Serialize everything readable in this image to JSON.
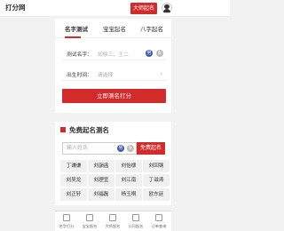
{
  "header": {
    "logo": "打分网",
    "master_button": "大师起名"
  },
  "tabs": [
    {
      "label": "名字测试"
    },
    {
      "label": "宝宝起名"
    },
    {
      "label": "八字起名"
    }
  ],
  "test_form": {
    "name_label": "测试名字：",
    "name_placeholder": "如徐三、王二",
    "male_icon": "男",
    "female_icon": "女",
    "birth_label": "出生时间：",
    "birth_placeholder": "请选择",
    "submit_label": "立即测名打分"
  },
  "free_section": {
    "title": "免费起名测名",
    "input_placeholder": "输入姓氏",
    "male_icon": "男",
    "female_icon": "女",
    "button_label": "免费起名",
    "names": [
      "丁谦谦",
      "刘韻函",
      "刘怡棣",
      "刘回钢",
      "刘吴龙",
      "刘理宜",
      "刘江南",
      "丁滋涛",
      "刘正轩",
      "刘福磊",
      "杨玉桐",
      "欧东廷"
    ]
  },
  "bottom_nav": [
    {
      "label": "名字打分"
    },
    {
      "label": "宝宝起名"
    },
    {
      "label": "大师起名"
    },
    {
      "label": "公司起名"
    },
    {
      "label": "订单查询"
    }
  ]
}
